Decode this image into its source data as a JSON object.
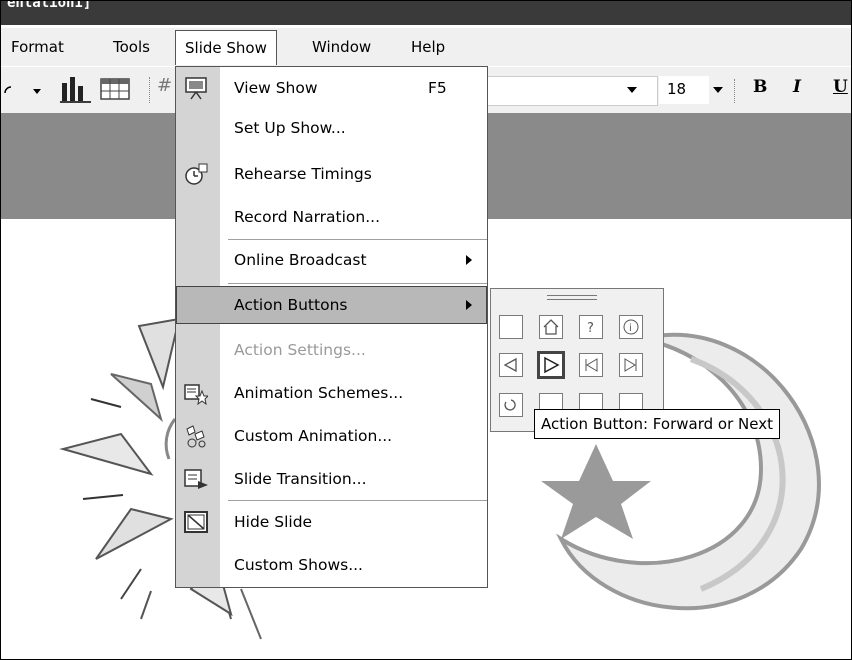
{
  "window": {
    "title_fragment": "entation1]"
  },
  "menubar": {
    "items": [
      {
        "label": "Format"
      },
      {
        "label": "Tools"
      },
      {
        "label": "Slide Show"
      },
      {
        "label": "Window"
      },
      {
        "label": "Help"
      }
    ]
  },
  "toolbar": {
    "font_size": "18",
    "bold": "B",
    "italic": "I",
    "underline": "U"
  },
  "slide_show_menu": {
    "items": [
      {
        "label": "View Show",
        "shortcut": "F5",
        "icon": "view-show-icon"
      },
      {
        "label": "Set Up Show..."
      },
      {
        "label": "Rehearse Timings",
        "icon": "rehearse-timings-icon"
      },
      {
        "label": "Record Narration..."
      },
      {
        "label": "Online Broadcast",
        "submenu": true
      },
      {
        "label": "Action Buttons",
        "submenu": true,
        "highlighted": true
      },
      {
        "label": "Action Settings...",
        "disabled": true
      },
      {
        "label": "Animation Schemes...",
        "icon": "animation-schemes-icon"
      },
      {
        "label": "Custom Animation...",
        "icon": "custom-animation-icon"
      },
      {
        "label": "Slide Transition...",
        "icon": "slide-transition-icon"
      },
      {
        "label": "Hide Slide",
        "icon": "hide-slide-icon"
      },
      {
        "label": "Custom Shows..."
      }
    ]
  },
  "action_buttons_palette": {
    "buttons": [
      "custom",
      "home",
      "help",
      "information",
      "back-or-previous",
      "forward-or-next",
      "beginning",
      "end",
      "return",
      "document",
      "sound",
      "movie"
    ],
    "selected": "forward-or-next"
  },
  "tooltip": {
    "text": "Action Button: Forward or Next"
  },
  "colors": {
    "menu_highlight": "#b8b8b8",
    "gutter": "#d4d4d4",
    "band": "#8a8a8a"
  }
}
